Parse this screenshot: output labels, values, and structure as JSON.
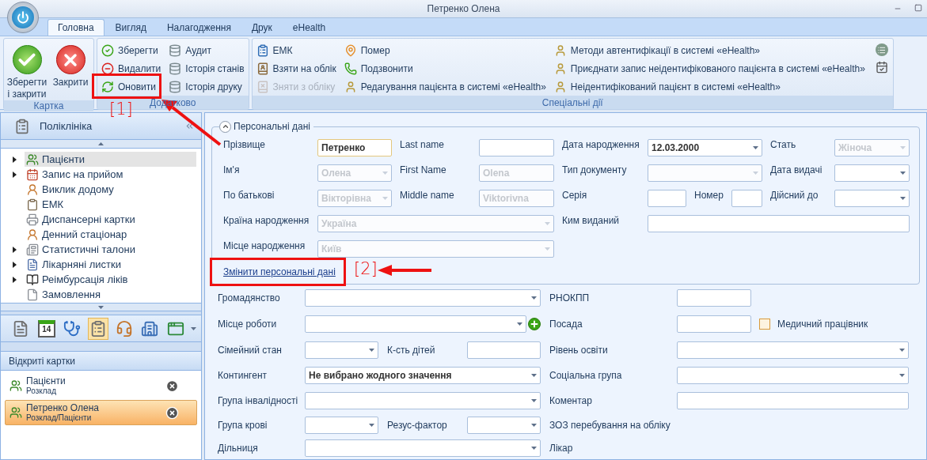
{
  "window": {
    "title": "Петренко Олена"
  },
  "tabs": [
    {
      "label": "Головна",
      "selected": true
    },
    {
      "label": "Вигляд",
      "selected": false
    },
    {
      "label": "Налагодження",
      "selected": false
    },
    {
      "label": "Друк",
      "selected": false
    },
    {
      "label": "eHealth",
      "selected": false
    }
  ],
  "ribbon": {
    "groups": [
      {
        "title": "Картка",
        "kind": "large",
        "columns": [
          [
            {
              "label": "Зберегти і закрити",
              "disabled": false
            }
          ],
          [
            {
              "label": "Закрити",
              "disabled": false
            }
          ]
        ]
      },
      {
        "title": "Додатково",
        "kind": "small",
        "columns": [
          [
            {
              "label": "Зберегти",
              "disabled": false
            },
            {
              "label": "Видалити",
              "disabled": false
            },
            {
              "label": "Оновити",
              "disabled": false
            }
          ],
          [
            {
              "label": "Аудит",
              "disabled": false
            },
            {
              "label": "Історія станів",
              "disabled": false
            },
            {
              "label": "Історія друку",
              "disabled": false
            }
          ]
        ]
      },
      {
        "title": "Спеціальні дії",
        "kind": "small",
        "columns": [
          [
            {
              "label": "ЕМК",
              "disabled": false
            },
            {
              "label": "Взяти на облік",
              "disabled": false
            },
            {
              "label": "Зняти з обліку",
              "disabled": true
            }
          ],
          [
            {
              "label": "Помер",
              "disabled": false
            },
            {
              "label": "Подзвонити",
              "disabled": false
            },
            {
              "label": "Редагування пацієнта в системі «eHealth»",
              "disabled": false
            }
          ],
          [
            {
              "label": "Методи автентифікації в системі «eHealth»",
              "disabled": false
            },
            {
              "label": "Приєднати запис неідентифікованого пацієнта в системі «eHealth»",
              "disabled": false
            },
            {
              "label": "Неідентифікований пацієнт в системі «eHealth»",
              "disabled": false
            }
          ]
        ]
      }
    ]
  },
  "navigator": {
    "title": "Поліклініка",
    "items": [
      {
        "label": "Пацієнти",
        "kind": "branch",
        "expanded": false,
        "selected": true
      },
      {
        "label": "Запис на прийом",
        "kind": "branch",
        "expanded": false,
        "selected": false
      },
      {
        "label": "Виклик додому",
        "kind": "leaf",
        "selected": false
      },
      {
        "label": "ЕМК",
        "kind": "leaf",
        "selected": false
      },
      {
        "label": "Диспансерні картки",
        "kind": "leaf",
        "selected": false
      },
      {
        "label": "Денний стаціонар",
        "kind": "leaf",
        "selected": false
      },
      {
        "label": "Статистичні талони",
        "kind": "branch",
        "expanded": false,
        "selected": false
      },
      {
        "label": "Лікарняні листки",
        "kind": "branch",
        "expanded": false,
        "selected": false
      },
      {
        "label": "Реімбурсація ліків",
        "kind": "branch",
        "expanded": false,
        "selected": false
      },
      {
        "label": "Замовлення",
        "kind": "leaf",
        "selected": false
      }
    ]
  },
  "toolbar": [
    {
      "selected": false
    },
    {
      "text": "14",
      "selected": false
    },
    {
      "selected": false
    },
    {
      "selected": true
    },
    {
      "selected": false
    },
    {
      "selected": false
    },
    {
      "selected": false
    }
  ],
  "open_cards": {
    "title": "Відкриті картки",
    "items": [
      {
        "title": "Пацієнти",
        "subtitle": "Розклад",
        "selected": false
      },
      {
        "title": "Петренко Олена",
        "subtitle": "Розклад/Пацієнти",
        "selected": true
      }
    ]
  },
  "personal": {
    "title": "Персональні дані",
    "expanded": true,
    "link": "Змінити персональні дані",
    "rows": [
      [
        {
          "label": "Прізвище",
          "field": {
            "kind": "text",
            "value": "Петренко",
            "disabled": false,
            "focused": true
          }
        },
        {
          "label": "Last name",
          "field": {
            "kind": "text",
            "disabled": false,
            "focused": false
          }
        },
        {
          "label": "Дата народження",
          "field": {
            "kind": "combo",
            "value": "12.03.2000",
            "disabled": false,
            "focused": false
          }
        },
        {
          "label": "Стать",
          "field": {
            "kind": "combo",
            "value": "Жіноча",
            "disabled": true,
            "focused": false
          }
        }
      ],
      [
        {
          "label": "Ім'я",
          "field": {
            "kind": "combo",
            "value": "Олена",
            "disabled": true,
            "focused": false
          }
        },
        {
          "label": "First Name",
          "field": {
            "kind": "text",
            "value": "Olena",
            "disabled": true,
            "focused": false
          }
        },
        {
          "label": "Тип документу",
          "field": {
            "kind": "combo",
            "disabled": true,
            "focused": false
          }
        },
        {
          "label": "Дата видачі",
          "field": {
            "kind": "combo",
            "disabled": false,
            "focused": false
          }
        }
      ],
      [
        {
          "label": "По батькові",
          "field": {
            "kind": "combo",
            "value": "Вікторівна",
            "disabled": true,
            "focused": false
          }
        },
        {
          "label": "Middle name",
          "field": {
            "kind": "text",
            "value": "Viktorivna",
            "disabled": true,
            "focused": false
          }
        },
        {
          "label": "Серія",
          "field": {
            "kind": "text",
            "disabled": false,
            "focused": false
          }
        },
        {
          "label": "Номер",
          "field": {
            "kind": "text",
            "disabled": false,
            "focused": false
          }
        },
        {
          "label": "Дійсний до",
          "field": {
            "kind": "combo",
            "disabled": false,
            "focused": false
          }
        }
      ],
      [
        {
          "label": "Країна народження",
          "field": {
            "kind": "combo",
            "value": "Україна",
            "disabled": true,
            "focused": false
          }
        },
        "",
        {
          "label": "Ким виданий",
          "field": {
            "kind": "text",
            "disabled": false,
            "focused": false
          }
        }
      ],
      [
        {
          "label": "Місце народження",
          "field": {
            "kind": "combo",
            "value": "Київ",
            "disabled": true,
            "focused": false
          }
        }
      ]
    ]
  },
  "details": {
    "rows": [
      [
        {
          "kind": "field",
          "label": "Громадянство",
          "field": {
            "kind": "combo"
          }
        },
        {
          "kind": "field",
          "label": "РНОКПП",
          "field": {
            "kind": "text"
          }
        }
      ],
      [
        {
          "kind": "field",
          "label": "Місце роботи",
          "field": {
            "kind": "combo",
            "addable": true
          }
        },
        {
          "kind": "field",
          "label": "Посада",
          "field": {
            "kind": "text"
          }
        },
        {
          "kind": "checkbox",
          "label": "Медичний працівник",
          "checked": false
        }
      ],
      [
        {
          "kind": "field",
          "label": "Сімейний стан",
          "field": {
            "kind": "combo"
          }
        },
        {
          "kind": "field",
          "label": "К-сть дітей",
          "field": {
            "kind": "text"
          }
        },
        {
          "kind": "field",
          "label": "Рівень освіти",
          "field": {
            "kind": "combo"
          }
        }
      ],
      [
        {
          "kind": "field",
          "label": "Контингент",
          "field": {
            "kind": "combo",
            "value": "Не вибрано жодного значення"
          }
        },
        "",
        {
          "kind": "field",
          "label": "Соціальна група",
          "field": {
            "kind": "combo"
          }
        }
      ],
      [
        {
          "kind": "field",
          "label": "Група інвалідності",
          "field": {
            "kind": "combo"
          }
        },
        "",
        {
          "kind": "field",
          "label": "Коментар",
          "field": {
            "kind": "text"
          }
        }
      ],
      [
        {
          "kind": "field",
          "label": "Група крові",
          "field": {
            "kind": "combo"
          }
        },
        {
          "kind": "field",
          "label": "Резус-фактор",
          "field": {
            "kind": "combo"
          }
        },
        {
          "kind": "label",
          "label": "ЗОЗ перебування на обліку"
        }
      ],
      [
        {
          "kind": "field",
          "label": "Дільниця",
          "field": {
            "kind": "combo"
          }
        },
        "",
        {
          "kind": "label",
          "label": "Лікар"
        }
      ]
    ]
  },
  "annotations": [
    {
      "label": "[1]"
    },
    {
      "label": "[2]"
    }
  ]
}
